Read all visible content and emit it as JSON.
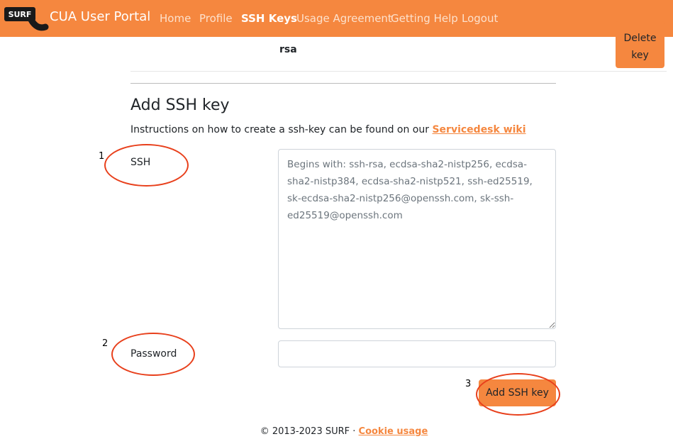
{
  "navbar": {
    "logo_text": "SURF",
    "title": "CUA User Portal",
    "items": [
      {
        "label": "Home",
        "active": false
      },
      {
        "label": "Profile",
        "active": false
      },
      {
        "label": "SSH Keys",
        "active": true
      },
      {
        "label": "Usage Agreement",
        "active": false
      },
      {
        "label": "Getting Help",
        "active": false
      },
      {
        "label": "Logout",
        "active": false
      }
    ],
    "bg_color": "#f5873f"
  },
  "existing_key": {
    "type_text": "rsa",
    "delete_label": "Delete key"
  },
  "add_form": {
    "title": "Add SSH key",
    "instructions_prefix": "Instructions on how to create a ssh-key can be found on our",
    "instructions_link": "Servicedesk wiki",
    "ssh_label": "SSH",
    "ssh_placeholder": "Begins with: ssh-rsa, ecdsa-sha2-nistp256, ecdsa-sha2-nistp384, ecdsa-sha2-nistp521, ssh-ed25519, sk-ecdsa-sha2-nistp256@openssh.com, sk-ssh-ed25519@openssh.com",
    "ssh_value": "",
    "password_label": "Password",
    "password_value": "",
    "submit_label": "Add SSH key"
  },
  "annotations": {
    "n1": "1",
    "n2": "2",
    "n3": "3",
    "ellipse_color": "#e8401c"
  },
  "footer": {
    "copyright": "© 2013-2023 SURF ·",
    "cookie_link": "Cookie usage"
  }
}
